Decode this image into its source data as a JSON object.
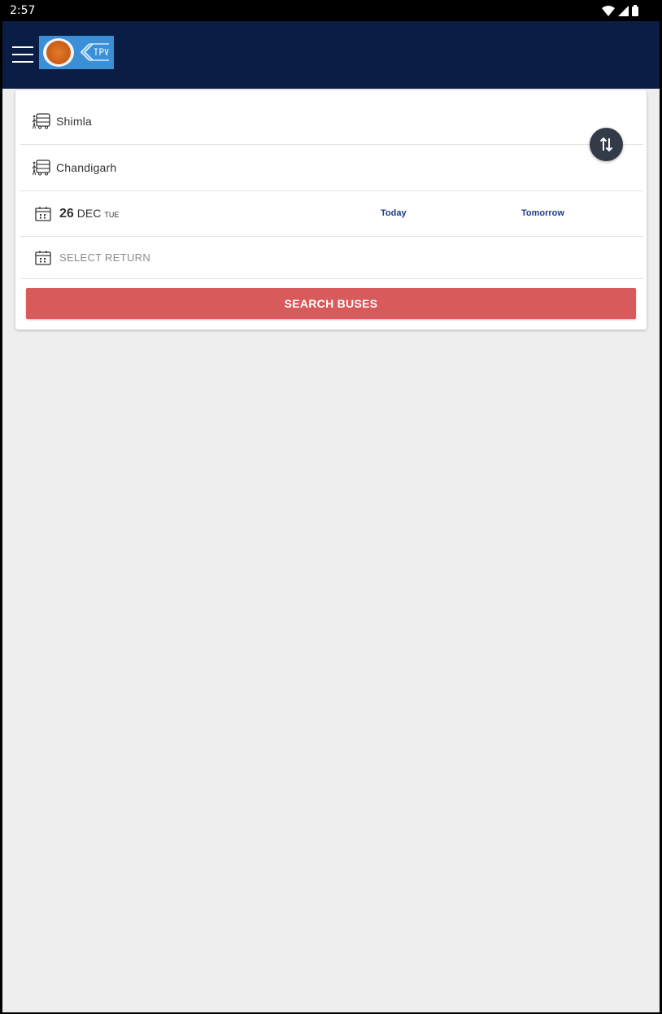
{
  "status_bar": {
    "time": "2:57",
    "icons": [
      "wifi-icon",
      "signal-icon",
      "battery-icon"
    ]
  },
  "app_bar": {
    "menu_icon": "hamburger-menu-icon",
    "logo": "hrtc-logo"
  },
  "search_form": {
    "from_city": "Shimla",
    "to_city": "Chandigarh",
    "journey_date": {
      "day": "26",
      "month": "DEC",
      "weekday": "TUE"
    },
    "quick_dates": {
      "today": "Today",
      "tomorrow": "Tomorrow"
    },
    "return_placeholder": "SELECT RETURN",
    "search_button": "SEARCH BUSES",
    "swap_icon": "swap-arrows-icon",
    "bus_icon": "bus-stop-icon",
    "calendar_icon": "calendar-icon"
  },
  "colors": {
    "app_bar": "#0a1e45",
    "search_button": "#d85a5a",
    "link_text": "#1b3c8c",
    "swap_button": "#333a48",
    "background": "#eeeeee"
  }
}
